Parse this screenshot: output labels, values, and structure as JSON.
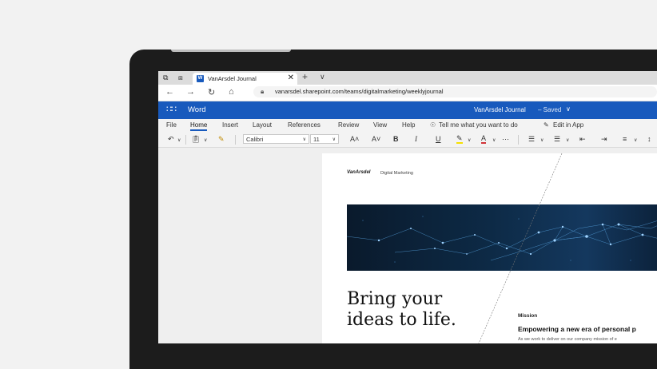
{
  "browser": {
    "tab_title": "VanArsdel Journal",
    "tab_icon": "word-icon",
    "url": "vanarsdel.sharepoint.com/teams/digitalmarketing/weeklyjournal"
  },
  "appbar": {
    "app_name": "Word",
    "doc_title": "VanArsdel Journal",
    "status": "– Saved",
    "color": "#185abd"
  },
  "ribbon": {
    "tabs": [
      "File",
      "Home",
      "Insert",
      "Layout",
      "References",
      "Review",
      "View",
      "Help"
    ],
    "active_tab": "Home",
    "tell_me": "Tell me what you want to do",
    "edit_in_app": "Edit in App"
  },
  "toolbar": {
    "font_name": "Calibri",
    "font_size": "11"
  },
  "document": {
    "brand": "VanArsdel",
    "brand_sub": "Digital Marketing",
    "headline_1": "Bring your",
    "headline_2": "ideas to life.",
    "mission_label": "Mission",
    "mission_title": "Empowering a new era of personal p",
    "mission_body": "As we work to deliver on our company mission of e"
  }
}
